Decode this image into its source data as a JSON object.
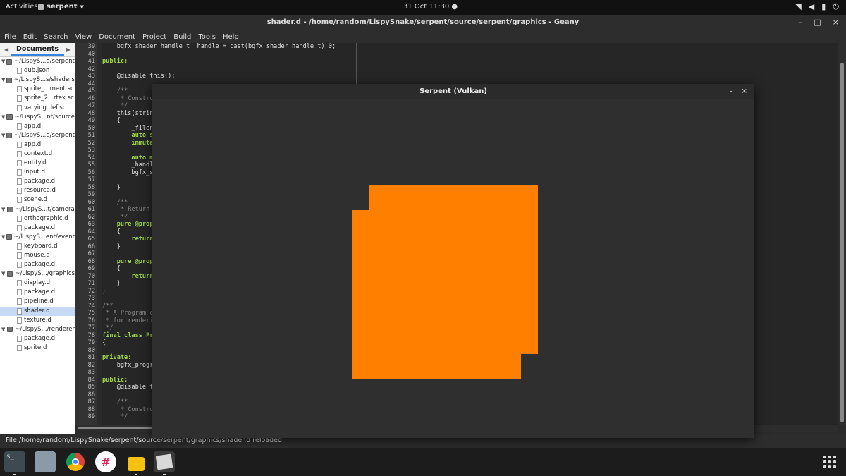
{
  "topbar": {
    "activities": "Activities",
    "app_name": "serpent",
    "clock": "31 Oct  11:30",
    "tray_icons": [
      "wifi-icon",
      "volume-icon",
      "battery-icon",
      "power-icon"
    ]
  },
  "window": {
    "title": "shader.d - /home/random/LispySnake/serpent/source/serpent/graphics - Geany"
  },
  "menu": [
    "File",
    "Edit",
    "Search",
    "View",
    "Document",
    "Project",
    "Build",
    "Tools",
    "Help"
  ],
  "sidebar": {
    "tab_label": "Documents",
    "rows": [
      {
        "type": "folder",
        "label": "~/LispyS...e/serpent"
      },
      {
        "type": "file",
        "label": "dub.json"
      },
      {
        "type": "folder",
        "label": "~/LispyS...s/shaders"
      },
      {
        "type": "file",
        "label": "sprite_...ment.sc"
      },
      {
        "type": "file",
        "label": "sprite_2...rtex.sc"
      },
      {
        "type": "file",
        "label": "varying.def.sc"
      },
      {
        "type": "folder",
        "label": "~/LispyS...nt/source"
      },
      {
        "type": "file",
        "label": "app.d"
      },
      {
        "type": "folder",
        "label": "~/LispyS...e/serpent"
      },
      {
        "type": "file",
        "label": "app.d"
      },
      {
        "type": "file",
        "label": "context.d"
      },
      {
        "type": "file",
        "label": "entity.d"
      },
      {
        "type": "file",
        "label": "input.d"
      },
      {
        "type": "file",
        "label": "package.d"
      },
      {
        "type": "file",
        "label": "resource.d"
      },
      {
        "type": "file",
        "label": "scene.d"
      },
      {
        "type": "folder",
        "label": "~/LispyS...t/camera"
      },
      {
        "type": "file",
        "label": "orthographic.d"
      },
      {
        "type": "file",
        "label": "package.d"
      },
      {
        "type": "folder",
        "label": "~/LispyS...ent/event"
      },
      {
        "type": "file",
        "label": "keyboard.d"
      },
      {
        "type": "file",
        "label": "mouse.d"
      },
      {
        "type": "file",
        "label": "package.d"
      },
      {
        "type": "folder",
        "label": "~/LispyS.../graphics"
      },
      {
        "type": "file",
        "label": "display.d"
      },
      {
        "type": "file",
        "label": "package.d"
      },
      {
        "type": "file",
        "label": "pipeline.d"
      },
      {
        "type": "file",
        "label": "shader.d",
        "selected": true
      },
      {
        "type": "file",
        "label": "texture.d"
      },
      {
        "type": "folder",
        "label": "~/LispyS.../renderer"
      },
      {
        "type": "file",
        "label": "package.d"
      },
      {
        "type": "file",
        "label": "sprite.d"
      }
    ]
  },
  "editor": {
    "lines": [
      {
        "n": "39",
        "t": "    bgfx_shader_handle_t _handle = cast(bgfx_shader_handle_t) 0;",
        "c": "pl"
      },
      {
        "n": "40",
        "t": "",
        "c": "pl"
      },
      {
        "n": "41",
        "t": "public:",
        "c": "kw"
      },
      {
        "n": "42",
        "t": "",
        "c": "pl"
      },
      {
        "n": "43",
        "t": "    @disable this();",
        "c": "pl"
      },
      {
        "n": "44",
        "t": "",
        "c": "pl"
      },
      {
        "n": "45",
        "t": "    /**",
        "c": "cm"
      },
      {
        "n": "46",
        "t": "     * Constru",
        "c": "cm"
      },
      {
        "n": "47",
        "t": "     */",
        "c": "cm"
      },
      {
        "n": "48",
        "t": "    this(strin",
        "c": "pl"
      },
      {
        "n": "49",
        "t": "    {",
        "c": "pl"
      },
      {
        "n": "50",
        "t": "        _filen",
        "c": "pl"
      },
      {
        "n": "51",
        "t": "        auto s",
        "c": "kw"
      },
      {
        "n": "52",
        "t": "        immuta",
        "c": "kw"
      },
      {
        "n": "53",
        "t": "",
        "c": "pl"
      },
      {
        "n": "54",
        "t": "        auto m",
        "c": "kw"
      },
      {
        "n": "55",
        "t": "        _handl",
        "c": "pl"
      },
      {
        "n": "56",
        "t": "        bgfx_s",
        "c": "pl"
      },
      {
        "n": "57",
        "t": "",
        "c": "pl"
      },
      {
        "n": "58",
        "t": "    }",
        "c": "pl"
      },
      {
        "n": "59",
        "t": "",
        "c": "pl"
      },
      {
        "n": "60",
        "t": "    /**",
        "c": "cm"
      },
      {
        "n": "61",
        "t": "     * Return",
        "c": "cm"
      },
      {
        "n": "62",
        "t": "     */",
        "c": "cm"
      },
      {
        "n": "63",
        "t": "    pure @prope",
        "c": "kw"
      },
      {
        "n": "64",
        "t": "    {",
        "c": "pl"
      },
      {
        "n": "65",
        "t": "        return",
        "c": "kw"
      },
      {
        "n": "66",
        "t": "    }",
        "c": "pl"
      },
      {
        "n": "67",
        "t": "",
        "c": "pl"
      },
      {
        "n": "68",
        "t": "    pure @prope",
        "c": "kw"
      },
      {
        "n": "69",
        "t": "    {",
        "c": "pl"
      },
      {
        "n": "70",
        "t": "        return",
        "c": "kw"
      },
      {
        "n": "71",
        "t": "    }",
        "c": "pl"
      },
      {
        "n": "72",
        "t": "}",
        "c": "pl"
      },
      {
        "n": "73",
        "t": "",
        "c": "pl"
      },
      {
        "n": "74",
        "t": "/**",
        "c": "cm"
      },
      {
        "n": "75",
        "t": " * A Program c",
        "c": "cm"
      },
      {
        "n": "76",
        "t": " * for renderi",
        "c": "cm"
      },
      {
        "n": "77",
        "t": " */",
        "c": "cm"
      },
      {
        "n": "78",
        "t": "final class Pr",
        "c": "kw"
      },
      {
        "n": "79",
        "t": "{",
        "c": "pl"
      },
      {
        "n": "80",
        "t": "",
        "c": "pl"
      },
      {
        "n": "81",
        "t": "private:",
        "c": "kw"
      },
      {
        "n": "82",
        "t": "    bgfx_progra",
        "c": "pl"
      },
      {
        "n": "83",
        "t": "",
        "c": "pl"
      },
      {
        "n": "84",
        "t": "public:",
        "c": "kw"
      },
      {
        "n": "85",
        "t": "    @disable th",
        "c": "pl"
      },
      {
        "n": "86",
        "t": "",
        "c": "pl"
      },
      {
        "n": "87",
        "t": "    /**",
        "c": "cm"
      },
      {
        "n": "88",
        "t": "     * Constru",
        "c": "cm"
      },
      {
        "n": "89",
        "t": "     */",
        "c": "cm"
      }
    ]
  },
  "status": {
    "text": "File /home/random/LispySnake/serpent/source/serpent/graphics/shader.d reloaded."
  },
  "vulkan_window": {
    "title": "Serpent (Vulkan)",
    "minimize": "–",
    "close": "×",
    "sprite_color": "#ff8000"
  },
  "dock": {
    "apps": [
      "terminal-icon",
      "files-icon",
      "chrome-icon",
      "slack-icon",
      "software-icon",
      "image-viewer-icon"
    ]
  }
}
